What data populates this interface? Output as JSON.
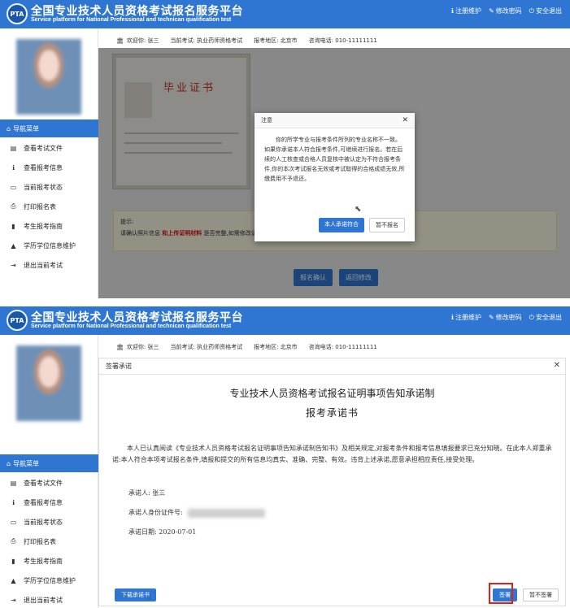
{
  "header": {
    "title_cn": "全国专业技术人员资格考试报名服务平台",
    "title_en": "Service platform for National Professional and technican qualification test",
    "logo_text": "PTA",
    "links": [
      {
        "icon": "info-icon",
        "glyph": "ℹ",
        "label": "注册维护"
      },
      {
        "icon": "edit-icon",
        "glyph": "✎",
        "label": "修改密码"
      },
      {
        "icon": "power-icon",
        "glyph": "⏻",
        "label": "安全退出"
      }
    ]
  },
  "infobar": {
    "welcome": "欢迎你: 张三",
    "exam": "当前考试:  执业药师资格考试",
    "region": "报考地区:  北京市",
    "phone": "咨询电话:  010-11111111"
  },
  "sidebar": {
    "nav_title": "导航菜单",
    "items": [
      {
        "icon": "document-icon",
        "glyph": "▤",
        "label": "查看考试文件"
      },
      {
        "icon": "info-icon",
        "glyph": "ℹ",
        "label": "查看报考信息"
      },
      {
        "icon": "monitor-icon",
        "glyph": "▭",
        "label": "当前报考状态"
      },
      {
        "icon": "printer-icon",
        "glyph": "⎙",
        "label": "打印报名表"
      },
      {
        "icon": "book-icon",
        "glyph": "▮",
        "label": "考生报考指南"
      },
      {
        "icon": "graduation-cap-icon",
        "glyph": "▲",
        "label": "学历学位信息维护"
      },
      {
        "icon": "exit-icon",
        "glyph": "⇥",
        "label": "退出当前考试"
      }
    ]
  },
  "panel1": {
    "certificate_title": "毕业证书",
    "notice_label": "提示:",
    "notice_text_a": "请确认照片信息",
    "notice_red": "和上传证明材料",
    "notice_text_b": "是否完整,如需修改请点击\"返回修改\"按钮进行信息修改。",
    "btn_confirm": "报名确认",
    "btn_back": "返回修改",
    "modal": {
      "title": "注意",
      "body": "你的所学专业与报考条件所列的专业名称不一致。如果你承诺本人符合报考条件,可继续进行报名。若在后续的人工核查或合格人员复核中被认定为不符合报考条件,你的本次考试报名无效或考试取得的合格成绩无效,所缴费用不予退还。",
      "btn_promise": "本人承诺符合",
      "btn_skip": "暂不报名"
    }
  },
  "panel2": {
    "modal_title": "签署承诺",
    "doc_title": "专业技术人员资格考试报名证明事项告知承诺制",
    "doc_subtitle": "报考承诺书",
    "body": "本人已认真阅读《专业技术人员资格考试报名证明事项告知承诺制告知书》及相关规定,对报考条件和报考信息填报要求已充分知晓。在此本人郑重承诺:本人符合本项考试报名条件,填报和提交的所有信息均真实、准确、完整、有效。违背上述承诺,愿意承担相应责任,接受处理。",
    "promiser": "承诺人: 张三",
    "id_label": "承诺人身份证件号:",
    "date": "承诺日期: 2020-07-01",
    "btn_download": "下载承诺书",
    "btn_sign": "签署",
    "btn_nosign": "暂不签署"
  }
}
